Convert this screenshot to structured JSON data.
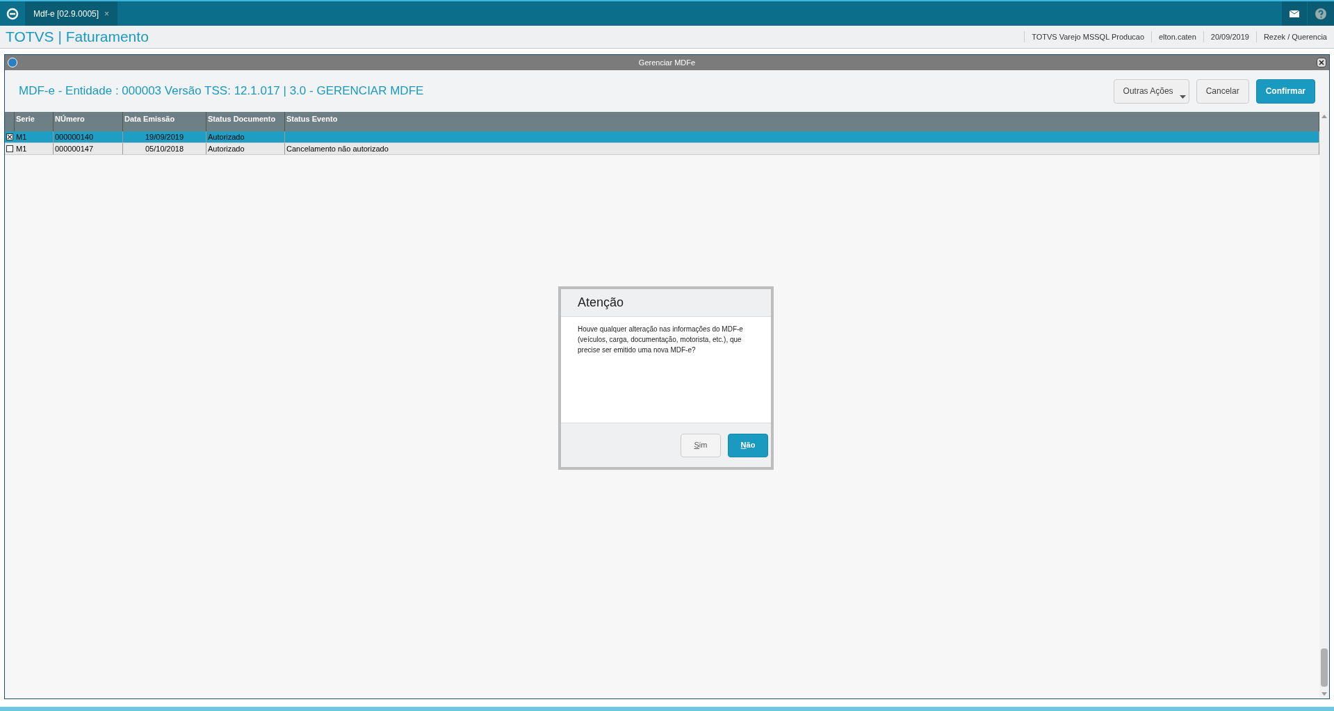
{
  "top_bar": {
    "tabs": [
      {
        "label": "Mdf-e [02.9.0005]",
        "close": "×",
        "selected": true
      }
    ]
  },
  "header": {
    "title": "TOTVS | Faturamento",
    "info": [
      "TOTVS Varejo MSSQL Producao",
      "elton.caten",
      "20/09/2019",
      "Rezek / Querencia"
    ]
  },
  "window": {
    "title": "Gerenciar MDFe",
    "heading": "MDF-e - Entidade : 000003 Versão TSS: 12.1.017 | 3.0 - GERENCIAR MDFE",
    "buttons": [
      {
        "label": "Outras Ações",
        "kind": "menu"
      },
      {
        "label": "Cancelar",
        "kind": "plain"
      },
      {
        "label": "Confirmar",
        "kind": "primary"
      }
    ]
  },
  "table": {
    "columns": [
      "Serie",
      "NÚmero",
      "Data Emissão",
      "Status Documento",
      "Status Evento"
    ],
    "rows": [
      {
        "checked": true,
        "selected": true,
        "cells": [
          "M1",
          "000000140",
          "19/09/2019",
          "Autorizado",
          ""
        ]
      },
      {
        "checked": false,
        "selected": false,
        "cells": [
          "M1",
          "000000147",
          "05/10/2018",
          "Autorizado",
          "Cancelamento não autorizado"
        ]
      }
    ]
  },
  "dialog": {
    "title": "Atenção",
    "message": "Houve qualquer alteração nas informações do MDF-e (veículos, carga, documentação, motorista, etc.), que precise ser emitido uma nova MDF-e?",
    "buttons": [
      {
        "label": "Sim",
        "selected": false
      },
      {
        "label": "Não",
        "selected": true
      }
    ]
  }
}
